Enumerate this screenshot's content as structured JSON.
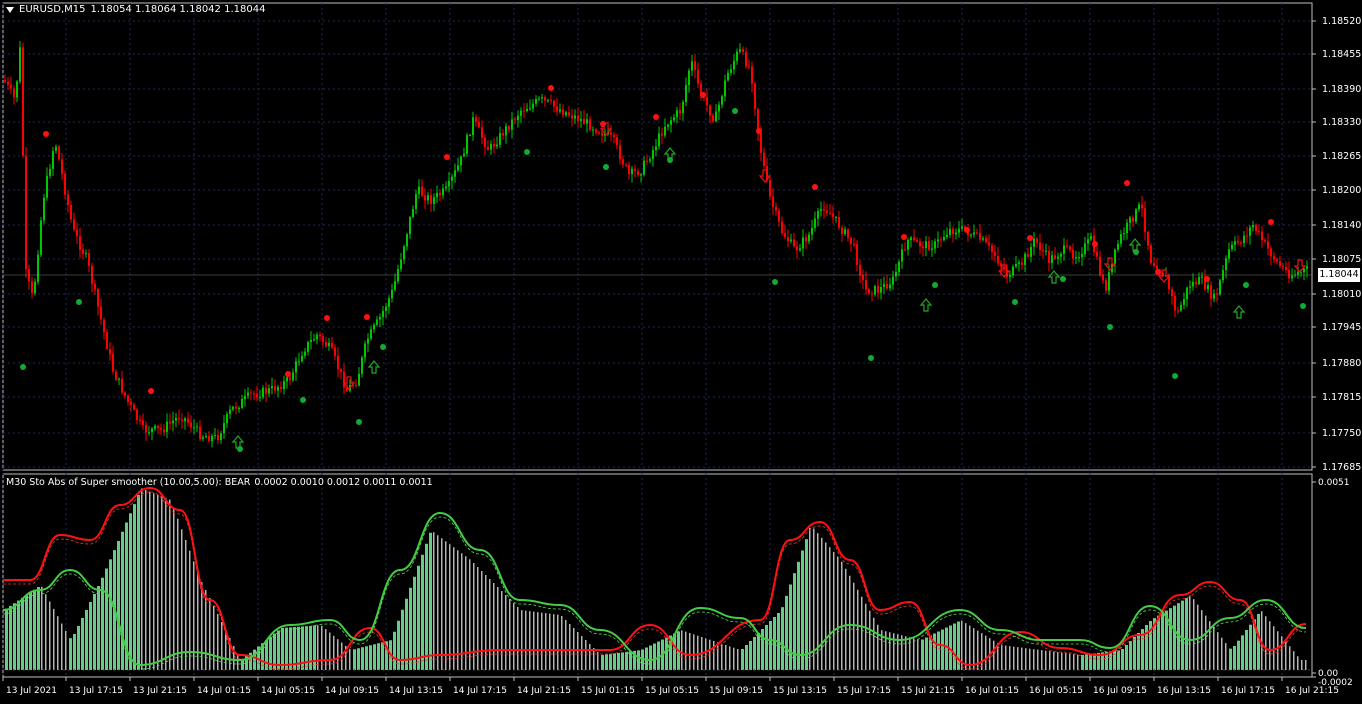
{
  "main_panel": {
    "symbol": "EURUSD,M15",
    "ohlc": "1.18054 1.18064 1.18042 1.18044",
    "current_price": "1.18044",
    "price_levels": [
      "1.18520",
      "1.18455",
      "1.18390",
      "1.18330",
      "1.18265",
      "1.18200",
      "1.18140",
      "1.18075",
      "1.18010",
      "1.17945",
      "1.17880",
      "1.17815",
      "1.17750",
      "1.17685"
    ]
  },
  "indicator_panel": {
    "title": "M30 Sto Abs of Super smoother (10.00,5.00): BEAR",
    "values": "0.0002 0.0010 0.0012 0.0011 0.0011",
    "scale_top": "0.0051",
    "scale_zero": "0.00",
    "scale_bottom": "-0.0002"
  },
  "time_axis": [
    "13 Jul 2021",
    "13 Jul 17:15",
    "13 Jul 21:15",
    "14 Jul 01:15",
    "14 Jul 05:15",
    "14 Jul 09:15",
    "14 Jul 13:15",
    "14 Jul 17:15",
    "14 Jul 21:15",
    "15 Jul 01:15",
    "15 Jul 05:15",
    "15 Jul 09:15",
    "15 Jul 13:15",
    "15 Jul 17:15",
    "15 Jul 21:15",
    "16 Jul 01:15",
    "16 Jul 05:15",
    "16 Jul 09:15",
    "16 Jul 13:15",
    "16 Jul 17:15",
    "16 Jul 21:15"
  ],
  "colors": {
    "bull": "#00c800",
    "bear": "#ff0000",
    "grid": "#1c2a56",
    "hist": "#66cc88",
    "hist_dim": "#b4b4b4",
    "border": "#c0c0c0"
  },
  "chart_data": {
    "type": "line",
    "title": "EURUSD,M15",
    "ylim": [
      1.17685,
      1.1855
    ],
    "x_labels": [
      "13 Jul 2021",
      "13 Jul 17:15",
      "13 Jul 21:15",
      "14 Jul 01:15",
      "14 Jul 05:15",
      "14 Jul 09:15",
      "14 Jul 13:15",
      "14 Jul 17:15",
      "14 Jul 21:15",
      "15 Jul 01:15",
      "15 Jul 05:15",
      "15 Jul 09:15",
      "15 Jul 13:15",
      "15 Jul 17:15",
      "15 Jul 21:15",
      "16 Jul 01:15",
      "16 Jul 05:15",
      "16 Jul 09:15",
      "16 Jul 13:15",
      "16 Jul 17:15",
      "16 Jul 21:15"
    ],
    "series": [
      {
        "values": [
          1.1838,
          1.1845,
          1.1823,
          1.1809,
          1.1832,
          1.1808,
          1.1789,
          1.1773,
          1.1775,
          1.1783,
          1.1792,
          1.1788,
          1.18,
          1.1788,
          1.1809,
          1.1827,
          1.1832,
          1.1836,
          1.184,
          1.1834,
          1.1831,
          1.1827,
          1.1822,
          1.1838,
          1.185,
          1.1835,
          1.181,
          1.1798,
          1.181,
          1.1802,
          1.1812,
          1.1815,
          1.1808,
          1.1812,
          1.1808,
          1.1812,
          1.1809,
          1.1818,
          1.1799,
          1.1805,
          1.1812,
          1.1808,
          1.1803,
          1.1804
        ]
      }
    ]
  }
}
